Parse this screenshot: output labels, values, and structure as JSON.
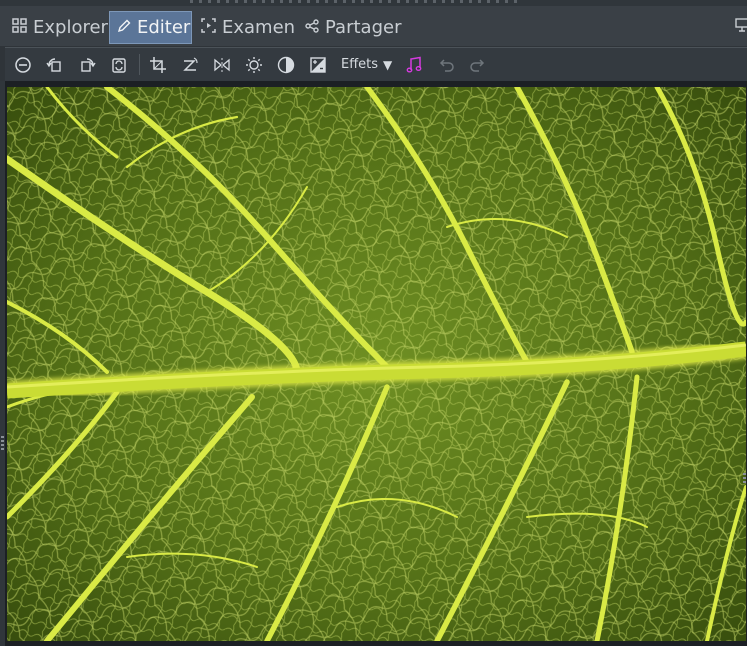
{
  "tabs": [
    {
      "label": "Explorer",
      "icon": "grid-icon"
    },
    {
      "label": "Editer",
      "icon": "pencil-icon",
      "active": true
    },
    {
      "label": "Examen",
      "icon": "presentation-icon"
    },
    {
      "label": "Partager",
      "icon": "share-icon"
    }
  ],
  "toolbar": {
    "effects_label": "Effets",
    "tools": [
      "zoom-out-icon",
      "rotate-left-icon",
      "rotate-right-icon",
      "auto-adjust-icon",
      "crop-icon",
      "straighten-icon",
      "flip-icon",
      "brightness-icon",
      "contrast-icon",
      "exposure-icon",
      "music-icon",
      "undo-icon",
      "redo-icon"
    ]
  },
  "colors": {
    "active_tab": "#5b7598",
    "music_accent": "#d63be0",
    "leaf_green": "#4f6b16",
    "vein_yellow": "#d6e63a"
  }
}
